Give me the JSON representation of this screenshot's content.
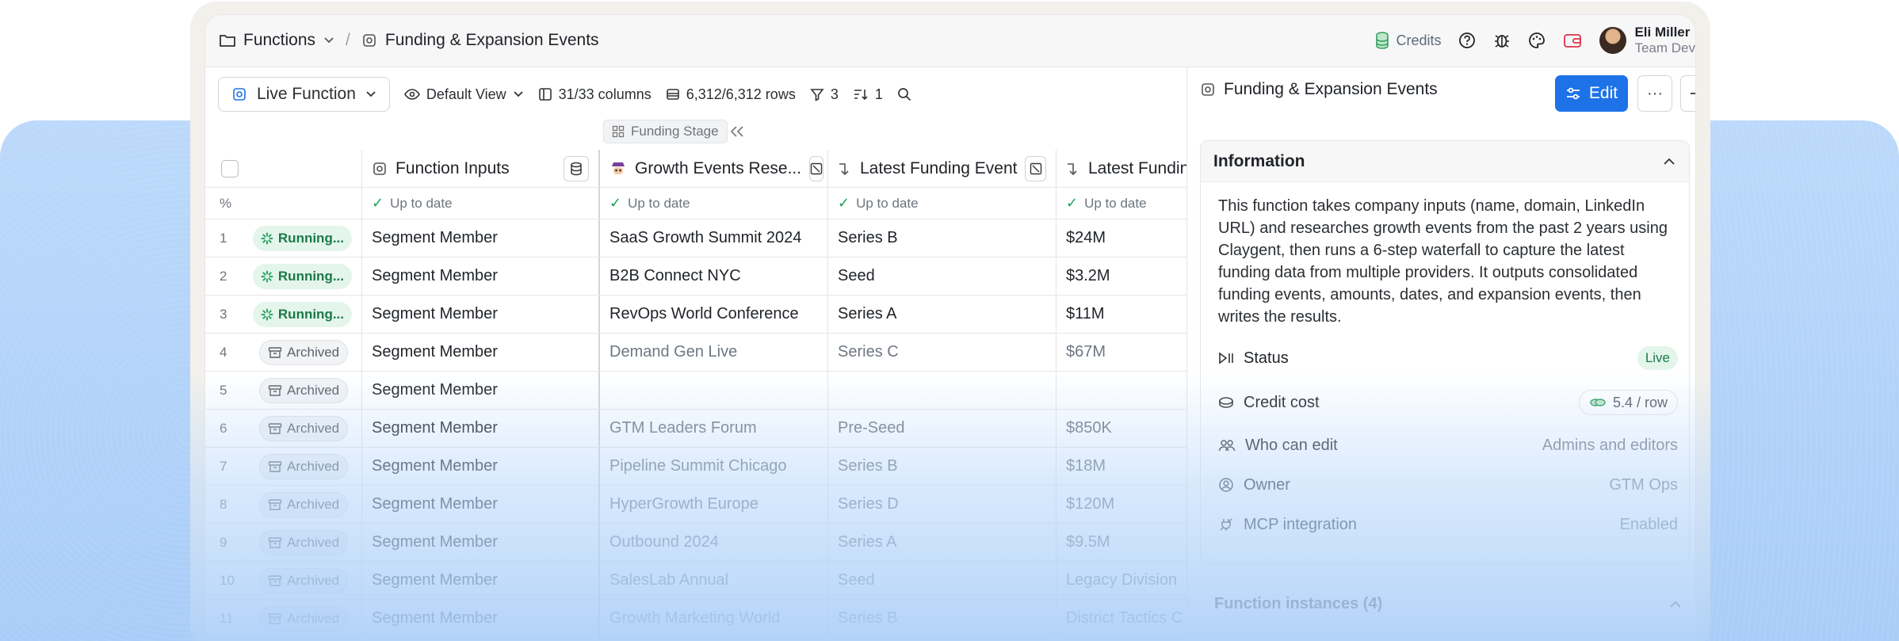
{
  "breadcrumb": {
    "root": "Functions",
    "separator": "/",
    "current": "Funding & Expansion Events"
  },
  "topbar": {
    "credits": "Credits",
    "user_name": "Eli Miller",
    "user_team": "Team Dev"
  },
  "toolbar": {
    "live_function": "Live Function",
    "view": "Default View",
    "columns": "31/33 columns",
    "rows": "6,312/6,312 rows",
    "filter_count": "3",
    "sort_count": "1"
  },
  "grid": {
    "group_label": "Funding Stage",
    "percent_symbol": "%",
    "columns": [
      {
        "label": "Function Inputs"
      },
      {
        "label": "Growth Events Rese..."
      },
      {
        "label": "Latest Funding Event"
      },
      {
        "label": "Latest Fundin"
      }
    ],
    "status_label": "Up to date",
    "rows": [
      {
        "num": "1",
        "state": "Running...",
        "kind": "running",
        "input": "Segment Member",
        "event": "SaaS Growth Summit 2024",
        "stage": "Series B",
        "amount": "$24M"
      },
      {
        "num": "2",
        "state": "Running...",
        "kind": "running",
        "input": "Segment Member",
        "event": "B2B Connect NYC",
        "stage": "Seed",
        "amount": "$3.2M"
      },
      {
        "num": "3",
        "state": "Running...",
        "kind": "running",
        "input": "Segment Member",
        "event": "RevOps World Conference",
        "stage": "Series A",
        "amount": "$11M"
      },
      {
        "num": "4",
        "state": "Archived",
        "kind": "archived",
        "input": "Segment Member",
        "event": "Demand Gen Live",
        "stage": "Series C",
        "amount": "$67M"
      },
      {
        "num": "5",
        "state": "Archived",
        "kind": "archived",
        "input": "Segment Member",
        "event": "",
        "stage": "",
        "amount": ""
      },
      {
        "num": "6",
        "state": "Archived",
        "kind": "archived",
        "input": "Segment Member",
        "event": "GTM Leaders Forum",
        "stage": "Pre-Seed",
        "amount": "$850K"
      },
      {
        "num": "7",
        "state": "Archived",
        "kind": "archived",
        "input": "Segment Member",
        "event": "Pipeline Summit Chicago",
        "stage": "Series B",
        "amount": "$18M"
      },
      {
        "num": "8",
        "state": "Archived",
        "kind": "archived",
        "input": "Segment Member",
        "event": "HyperGrowth Europe",
        "stage": "Series D",
        "amount": "$120M"
      },
      {
        "num": "9",
        "state": "Archived",
        "kind": "archived",
        "input": "Segment Member",
        "event": "Outbound 2024",
        "stage": "Series A",
        "amount": "$9.5M"
      },
      {
        "num": "10",
        "state": "Archived",
        "kind": "archived",
        "input": "Segment Member",
        "event": "SalesLab Annual",
        "stage": "Seed",
        "amount": "Legacy Division"
      },
      {
        "num": "11",
        "state": "Archived",
        "kind": "archived",
        "input": "Segment Member",
        "event": "Growth Marketing World",
        "stage": "Series B",
        "amount": "District Tactics C"
      }
    ]
  },
  "panel": {
    "title": "Funding & Expansion Events",
    "edit_label": "Edit",
    "more_label": "···",
    "info_title": "Information",
    "description": "This function takes company inputs (name, domain, LinkedIn URL) and researches growth events from the past 2 years using Claygent, then runs a 6-step waterfall to capture the latest funding data from multiple providers. It outputs consolidated funding events, amounts, dates, and expansion events, then writes the results.",
    "status_label": "Status",
    "status_value": "Live",
    "credit_label": "Credit cost",
    "credit_value": "5.4 / row",
    "edit_perm_label": "Who can edit",
    "edit_perm_value": "Admins and editors",
    "owner_label": "Owner",
    "owner_value": "GTM Ops",
    "mcp_label": "MCP integration",
    "mcp_value": "Enabled",
    "instances": "Function instances (4)"
  },
  "colors": {
    "accent": "#1d72e8",
    "running_bg": "#e4f5ec",
    "running_fg": "#1b7a47",
    "backdrop": "#bcd9fb"
  }
}
